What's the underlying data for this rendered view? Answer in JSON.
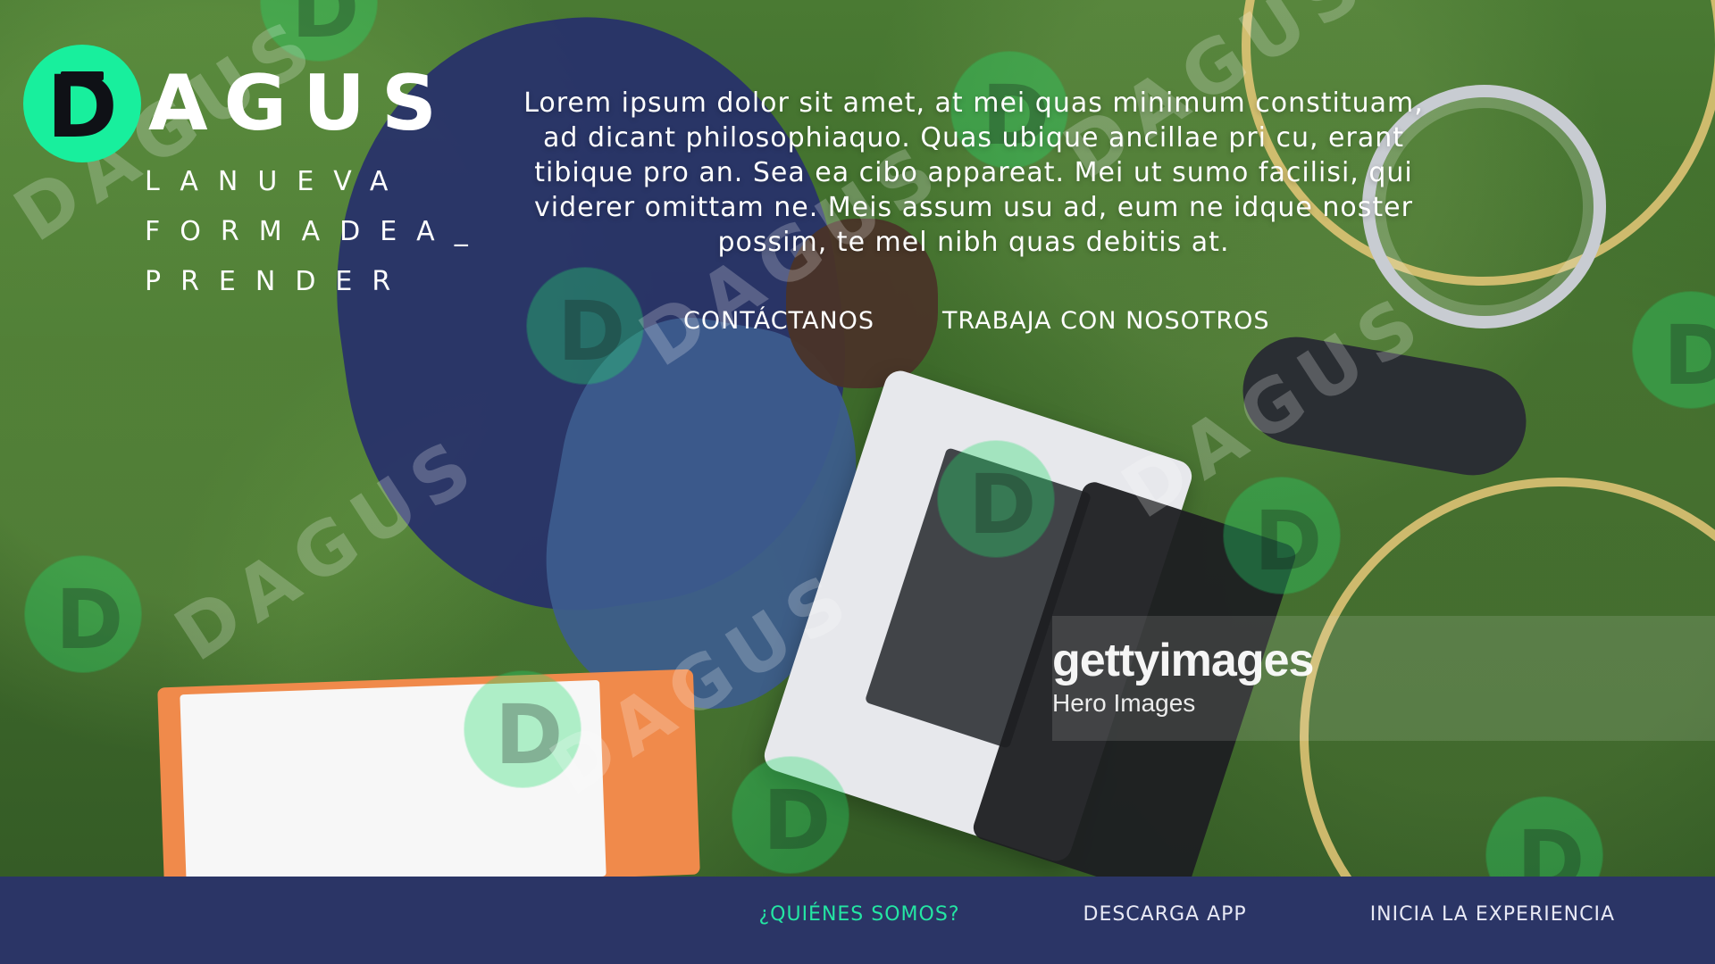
{
  "brand": {
    "logo_letter": "D",
    "logo_word": "AGUS",
    "tagline_lines": [
      "LANUEVA",
      "FORMADEA_",
      "PRENDER"
    ],
    "accent_color": "#18ef9d",
    "footer_bg": "#2b3566"
  },
  "hero": {
    "intro_paragraph": "Lorem ipsum dolor sit amet, at mei quas minimum constituam, ad dicant philosophiaquo. Quas ubique ancillae pri cu, erant tibique pro an. Sea ea cibo appareat. Mei ut sumo facilisi, qui viderer omittam ne. Meis assum usu ad, eum ne idque noster possim, te mel nibh quas debitis at.",
    "cta_contact": "CONTÁCTANOS",
    "cta_work": "TRABAJA CON NOSOTROS",
    "watermark_text": "DAGUS",
    "getty_brand": "gettyimages",
    "getty_sub": "Hero Images"
  },
  "footer": {
    "nav": [
      {
        "label": "¿QUIÉNES SOMOS?",
        "active": true
      },
      {
        "label": "DESCARGA APP",
        "active": false
      },
      {
        "label": "INICIA LA EXPERIENCIA",
        "active": false
      }
    ]
  }
}
